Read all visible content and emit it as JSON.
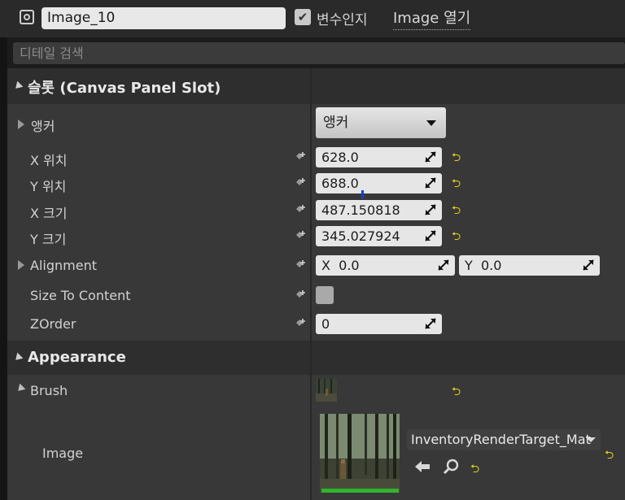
{
  "header": {
    "widget_name": "Image_10",
    "is_variable_label": "변수인지",
    "is_variable_checked": true,
    "open_image_label": "Image 열기"
  },
  "search": {
    "placeholder": "디테일 검색"
  },
  "slot_section": {
    "title": "슬롯 (Canvas Panel Slot)",
    "anchor": {
      "label": "앵커",
      "value": "앵커"
    },
    "pos_x": {
      "label": "X 위치",
      "value": "628.0"
    },
    "pos_y": {
      "label": "Y 위치",
      "value": "688.0"
    },
    "size_x": {
      "label": "X 크기",
      "value": "487.150818"
    },
    "size_y": {
      "label": "Y 크기",
      "value": "345.027924"
    },
    "alignment": {
      "label": "Alignment",
      "x_axis": "X",
      "x_value": "0.0",
      "y_axis": "Y",
      "y_value": "0.0"
    },
    "size_to_content": {
      "label": "Size To Content",
      "checked": false
    },
    "zorder": {
      "label": "ZOrder",
      "value": "0"
    }
  },
  "appearance_section": {
    "title": "Appearance",
    "brush": {
      "label": "Brush"
    },
    "image": {
      "label": "Image",
      "asset": "InventoryRenderTarget_Mat"
    }
  },
  "icons": {
    "widget": "widget-icon",
    "keyframe": "keyframe-diamond-plus-icon",
    "spin": "spin-drag-icon",
    "reset": "reset-to-default-arrow-icon",
    "back": "use-selected-arrow-icon",
    "browse": "browse-magnifier-icon"
  },
  "colors": {
    "reset": "#e4d21c",
    "thumbnail_bar": "#2fb52f",
    "panel_bg": "#383838",
    "category_bg": "#2e2e2e"
  }
}
